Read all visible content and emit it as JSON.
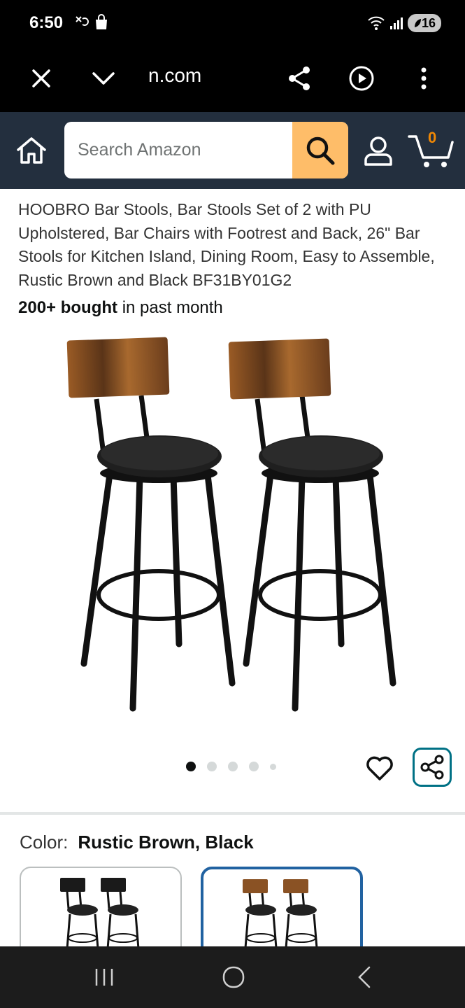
{
  "status_bar": {
    "time": "6:50",
    "battery": "16"
  },
  "browser": {
    "url": "n.com"
  },
  "header": {
    "search_placeholder": "Search Amazon",
    "cart_count": "0"
  },
  "product": {
    "title": "HOOBRO Bar Stools, Bar Stools Set of 2 with PU Upholstered, Bar Chairs with Footrest and Back, 26\" Bar Stools for Kitchen Island, Dining Room, Easy to Assemble, Rustic Brown and Black BF31BY01G2",
    "bought_bold": "200+ bought",
    "bought_rest": " in past month",
    "image_count": 5,
    "active_image": 1
  },
  "color": {
    "label": "Color:",
    "value": "Rustic Brown, Black"
  },
  "colors": {
    "accent": "#007185",
    "header_bg": "#232f3e",
    "search_btn": "#febd69",
    "selected_border": "#2162a1",
    "cart_count": "#f08804"
  }
}
